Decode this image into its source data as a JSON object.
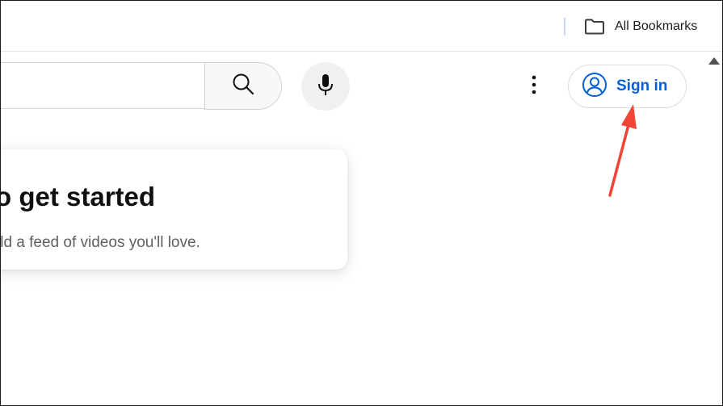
{
  "bookmarks_bar": {
    "all_bookmarks_label": "All Bookmarks",
    "folder_icon": "folder-icon"
  },
  "masthead": {
    "search_icon": "search-icon",
    "mic_icon": "microphone-icon",
    "more_icon": "vertical-dots-icon",
    "sign_in_label": "Sign in",
    "sign_in_icon": "account-circle-icon"
  },
  "card": {
    "title": "o get started",
    "subtitle": "ild a feed of videos you'll love."
  },
  "colors": {
    "sign_in_blue": "#065fd4",
    "annotation_red": "#f04438",
    "card_title": "#0f0f0f",
    "card_subtitle": "#606060"
  }
}
